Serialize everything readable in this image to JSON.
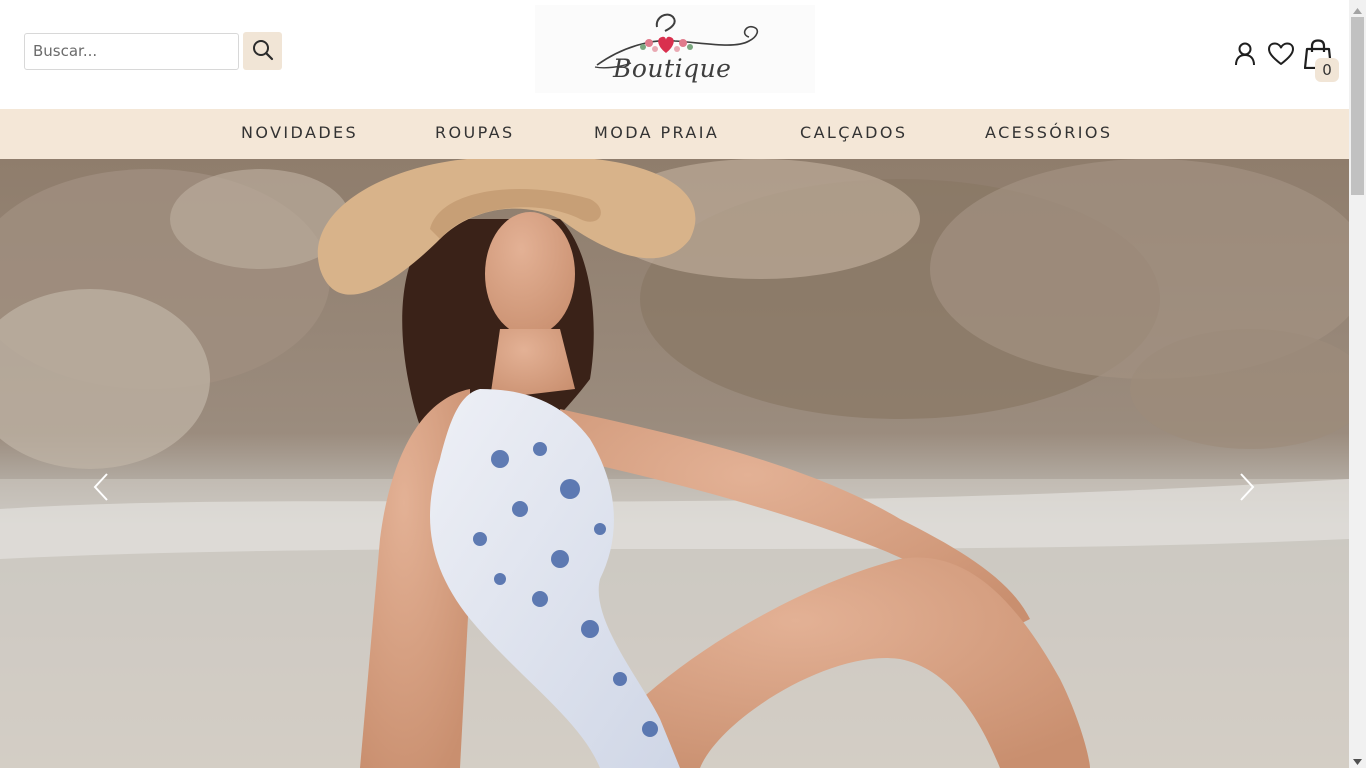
{
  "search": {
    "placeholder": "Buscar..."
  },
  "icons": {
    "search": "search-icon",
    "account": "user-icon",
    "wishlist": "heart-icon",
    "cart": "shopping-bag-icon"
  },
  "logo": {
    "text": "Boutique"
  },
  "cart": {
    "count": "0"
  },
  "nav": {
    "items": [
      {
        "label": "NOVIDADES"
      },
      {
        "label": "ROUPAS"
      },
      {
        "label": "MODA PRAIA"
      },
      {
        "label": "CALÇADOS"
      },
      {
        "label": "ACESSÓRIOS"
      }
    ]
  },
  "colors": {
    "nav_background": "#f4e7d7",
    "button_background": "#f1e5d6",
    "text": "#333333"
  }
}
